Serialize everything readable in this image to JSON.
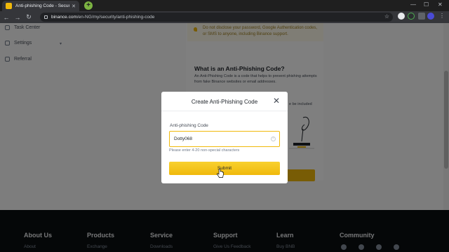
{
  "browser": {
    "tab_title": "Anti-phishing Code - Security - B",
    "tab_close": "✕",
    "url_domain": "binance.com",
    "url_path": "/en-NG/my/security/anti-phishing-code"
  },
  "sidebar": {
    "items": [
      {
        "label": "Task Center",
        "icon": "task-icon"
      },
      {
        "label": "Settings",
        "icon": "gear-icon"
      },
      {
        "label": "Referral",
        "icon": "referral-icon"
      }
    ]
  },
  "content": {
    "warning": "Do not disclose your password, Google Authentication codes, or SMS to anyone, including Binance support.",
    "heading": "What is an Anti-Phishing Code?",
    "description": "An Anti-Phishing Code is a code that helps to prevent phishing attempts from fake Binance websites or email addresses.",
    "partial_text": "e be included"
  },
  "footer": {
    "columns": [
      {
        "title": "About Us",
        "link": "About"
      },
      {
        "title": "Products",
        "link": "Exchange"
      },
      {
        "title": "Service",
        "link": "Downloads"
      },
      {
        "title": "Support",
        "link": "Give Us Feedback"
      },
      {
        "title": "Learn",
        "link": "Buy BNB"
      },
      {
        "title": "Community",
        "link": ""
      }
    ]
  },
  "modal": {
    "title": "Create Anti-Phishing Code",
    "close_icon": "close-icon",
    "field_label": "Anti-phishing Code",
    "field_value": "Dotty068",
    "hint": "Please enter 4-20 non-special characters",
    "submit_label": "Submit"
  },
  "colors": {
    "accent": "#f0b90b",
    "footer_bg": "#0b0e11",
    "overlay": "rgba(0,0,0,0.5)"
  }
}
